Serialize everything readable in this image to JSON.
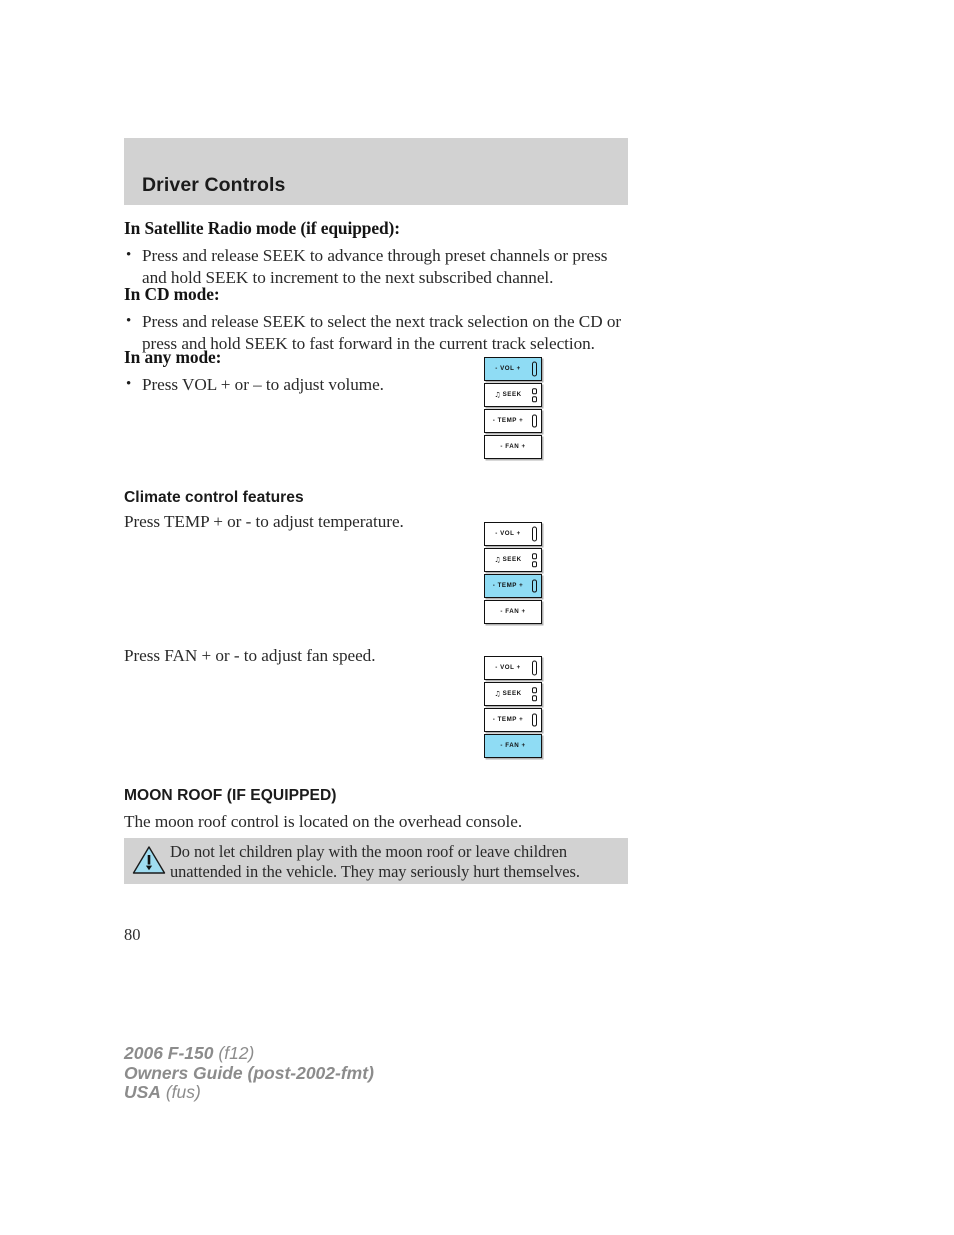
{
  "header": {
    "title": "Driver Controls",
    "band_color": "#d2d2d2"
  },
  "sections": {
    "satellite": {
      "heading": "In Satellite Radio mode (if equipped):",
      "bullets": [
        "Press and release SEEK to advance through preset channels or press and hold SEEK to increment to the next subscribed channel."
      ]
    },
    "cd": {
      "heading": "In CD mode:",
      "bullets": [
        "Press and release SEEK to select the next track selection on the CD or press and hold SEEK to fast forward in the current track selection."
      ]
    },
    "any_mode": {
      "heading": "In any mode:",
      "bullets": [
        "Press VOL + or – to adjust volume."
      ]
    },
    "climate": {
      "heading": "Climate control features",
      "temp_text": "Press TEMP + or - to adjust temperature.",
      "fan_text": "Press FAN + or - to adjust fan speed."
    },
    "moon_roof": {
      "heading": "MOON ROOF (IF EQUIPPED)",
      "body": "The moon roof control is located on the overhead console."
    }
  },
  "warning": {
    "icon": "warning-triangle-icon",
    "text": "Do not let children play with the moon roof or leave children unattended in the vehicle. They may seriously hurt themselves.",
    "box_color": "#d2d2d2",
    "triangle_fill": "#9fdcf0"
  },
  "control_panels": {
    "highlight_color": "#8fdcf4",
    "panels": [
      {
        "id": "volume-panel",
        "active": "VOL",
        "buttons": [
          {
            "label": "- VOL +",
            "icon": "rocker-single-tall",
            "note": false
          },
          {
            "label": "SEEK",
            "icon": "rocker-dual",
            "note": true
          },
          {
            "label": "- TEMP +",
            "icon": "rocker-single",
            "note": false
          },
          {
            "label": "- FAN +",
            "icon": "none",
            "note": false
          }
        ]
      },
      {
        "id": "temperature-panel",
        "active": "TEMP",
        "buttons": [
          {
            "label": "- VOL +",
            "icon": "rocker-single-tall",
            "note": false
          },
          {
            "label": "SEEK",
            "icon": "rocker-dual",
            "note": true
          },
          {
            "label": "- TEMP +",
            "icon": "rocker-single",
            "note": false
          },
          {
            "label": "- FAN +",
            "icon": "none",
            "note": false
          }
        ]
      },
      {
        "id": "fan-panel",
        "active": "FAN",
        "buttons": [
          {
            "label": "- VOL +",
            "icon": "rocker-single-tall",
            "note": false
          },
          {
            "label": "SEEK",
            "icon": "rocker-dual",
            "note": true
          },
          {
            "label": "- TEMP +",
            "icon": "rocker-single",
            "note": false
          },
          {
            "label": "- FAN +",
            "icon": "none",
            "note": false
          }
        ]
      }
    ],
    "note_glyph": "♫"
  },
  "page_number": "80",
  "footer": {
    "line1_strong": "2006 F-150",
    "line1_light": " (f12)",
    "line2_strong": "Owners Guide (post-2002-fmt)",
    "line2_light": "",
    "line3_strong": "USA",
    "line3_light": " (fus)"
  }
}
